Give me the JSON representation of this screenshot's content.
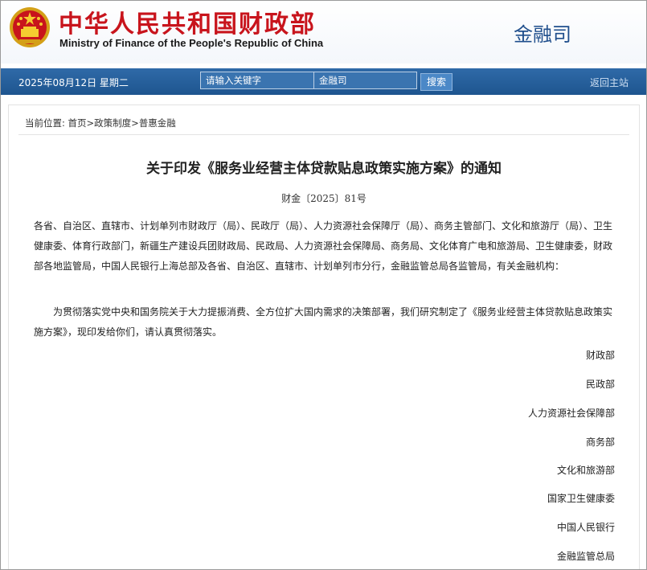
{
  "header": {
    "title_cn": "中华人民共和国财政部",
    "title_en": "Ministry of Finance of the People's Republic of China",
    "department": "金融司"
  },
  "navbar": {
    "date": "2025年08月12日 星期二",
    "search_value": "请输入关键字",
    "select_value": "金融司",
    "search_button": "搜索",
    "home_link": "返回主站"
  },
  "breadcrumb": {
    "prefix": "当前位置:",
    "items": [
      "首页",
      "政策制度",
      "普惠金融"
    ],
    "separator": ">"
  },
  "document": {
    "title": "关于印发《服务业经营主体贷款贴息政策实施方案》的通知",
    "number": "财金〔2025〕81号",
    "addressee": "各省、自治区、直辖市、计划单列市财政厅（局）、民政厅（局）、人力资源社会保障厅（局）、商务主管部门、文化和旅游厅（局）、卫生健康委、体育行政部门，新疆生产建设兵团财政局、民政局、人力资源社会保障局、商务局、文化体育广电和旅游局、卫生健康委，财政部各地监管局，中国人民银行上海总部及各省、自治区、直辖市、计划单列市分行，金融监管总局各监管局，有关金融机构：",
    "body": "为贯彻落实党中央和国务院关于大力提振消费、全方位扩大国内需求的决策部署，我们研究制定了《服务业经营主体贷款贴息政策实施方案》，现印发给你们，请认真贯彻落实。",
    "signers": [
      "财政部",
      "民政部",
      "人力资源社会保障部",
      "商务部",
      "文化和旅游部",
      "国家卫生健康委",
      "中国人民银行",
      "金融监管总局"
    ]
  },
  "colors": {
    "brand_red": "#c8141c",
    "nav_blue": "#2463a0",
    "dept_blue": "#1f4e8c"
  }
}
